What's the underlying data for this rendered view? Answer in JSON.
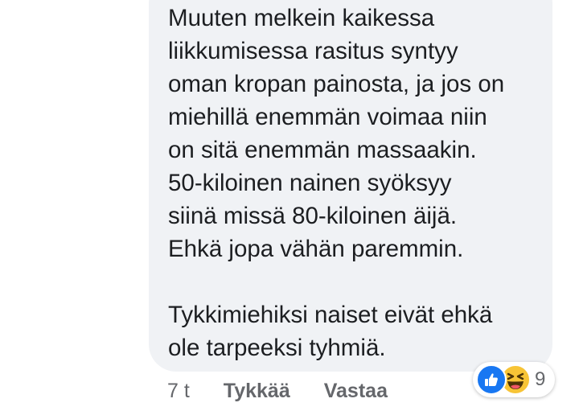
{
  "comment": {
    "text": "Muuten melkein kaikessa\nliikkumisessa rasitus syntyy\noman kropan painosta, ja jos on\nmiehillä enemmän voimaa niin\non sitä enemmän massaakin.\n50-kiloinen nainen syöksyy\nsiinä missä 80-kiloinen äijä.\nEhkä jopa vähän paremmin.\n\nTykkimiehiksi naiset eivät ehkä\nole tarpeeksi tyhmiä."
  },
  "actions": {
    "time": "7 t",
    "like_label": "Tykkää",
    "reply_label": "Vastaa"
  },
  "reactions": {
    "icons": [
      "like-icon",
      "haha-icon"
    ],
    "count": "9"
  },
  "colors": {
    "bubble": "#f0f2f5",
    "text": "#1c1e21",
    "meta": "#65676b",
    "like": "#1877f2",
    "haha": "#f7c436"
  }
}
